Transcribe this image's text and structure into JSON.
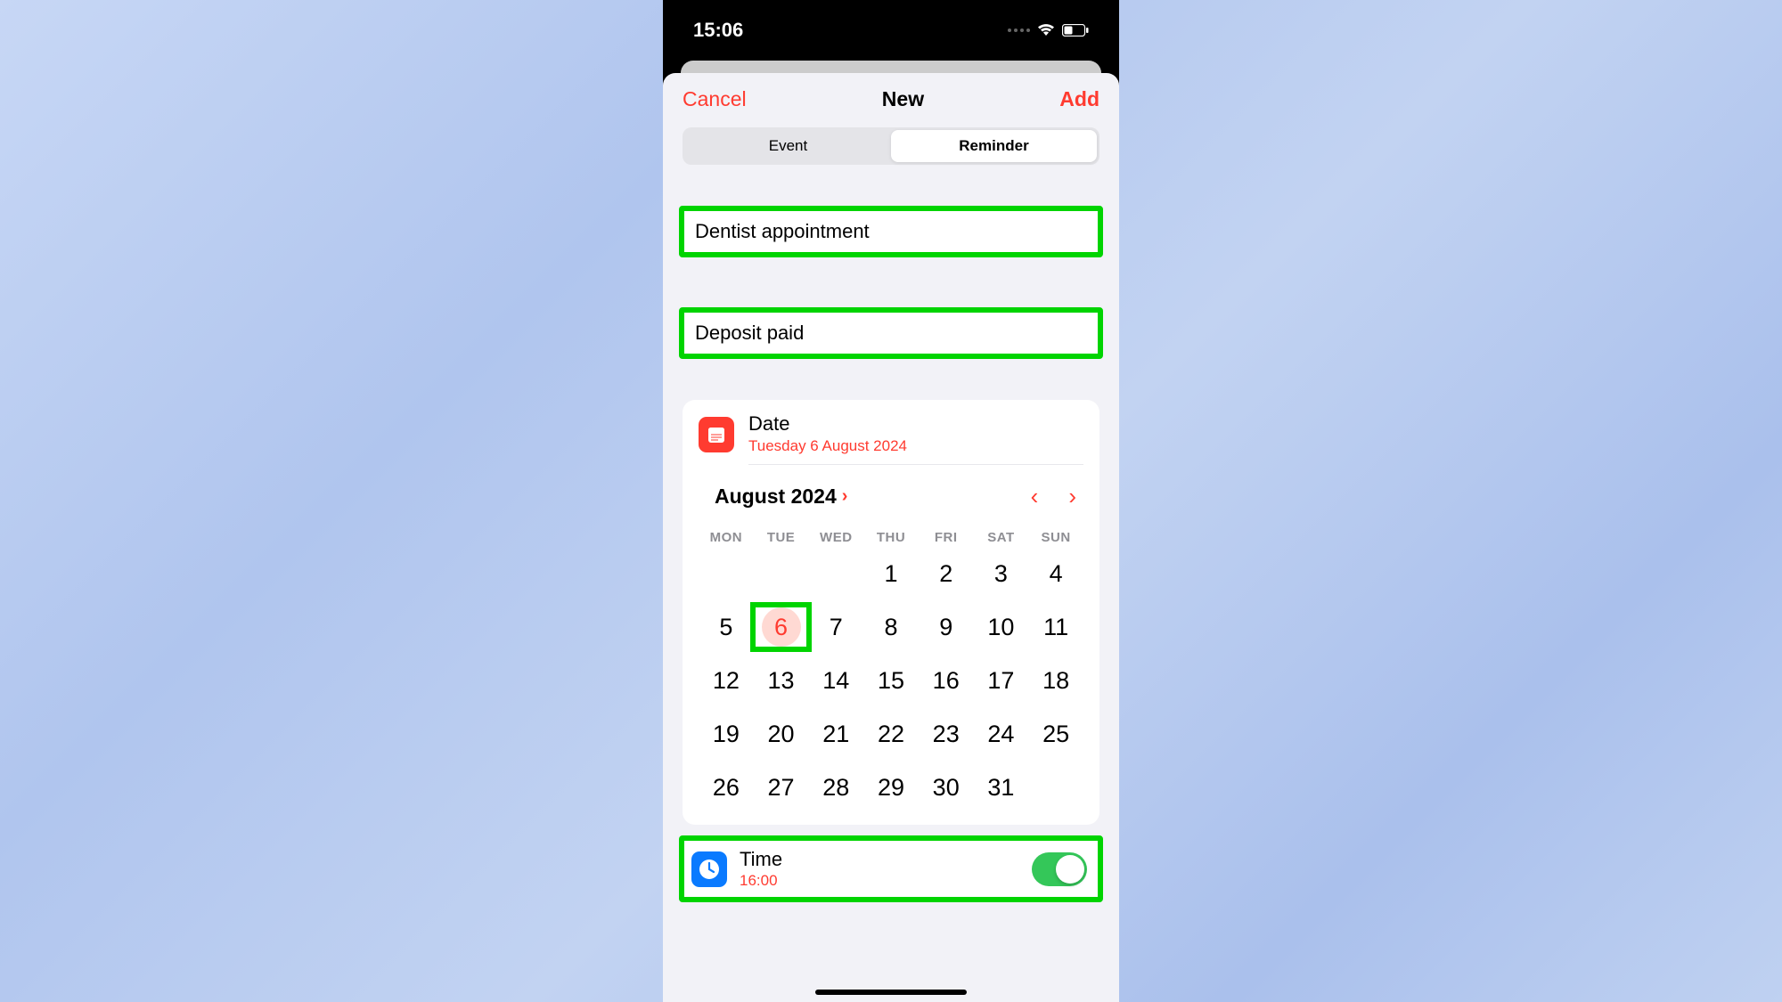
{
  "status": {
    "time": "15:06"
  },
  "nav": {
    "cancel": "Cancel",
    "title": "New",
    "add": "Add"
  },
  "segment": {
    "event": "Event",
    "reminder": "Reminder"
  },
  "fields": {
    "title_value": "Dentist appointment",
    "notes_value": "Deposit paid"
  },
  "date": {
    "label": "Date",
    "value": "Tuesday 6 August 2024"
  },
  "calendar": {
    "month_label": "August 2024",
    "dow": [
      "MON",
      "TUE",
      "WED",
      "THU",
      "FRI",
      "SAT",
      "SUN"
    ],
    "weeks": [
      [
        "",
        "",
        "",
        "1",
        "2",
        "3",
        "4"
      ],
      [
        "5",
        "6",
        "7",
        "8",
        "9",
        "10",
        "11"
      ],
      [
        "12",
        "13",
        "14",
        "15",
        "16",
        "17",
        "18"
      ],
      [
        "19",
        "20",
        "21",
        "22",
        "23",
        "24",
        "25"
      ],
      [
        "26",
        "27",
        "28",
        "29",
        "30",
        "31",
        ""
      ]
    ],
    "selected": "6"
  },
  "time": {
    "label": "Time",
    "value": "16:00",
    "toggle_on": true
  }
}
